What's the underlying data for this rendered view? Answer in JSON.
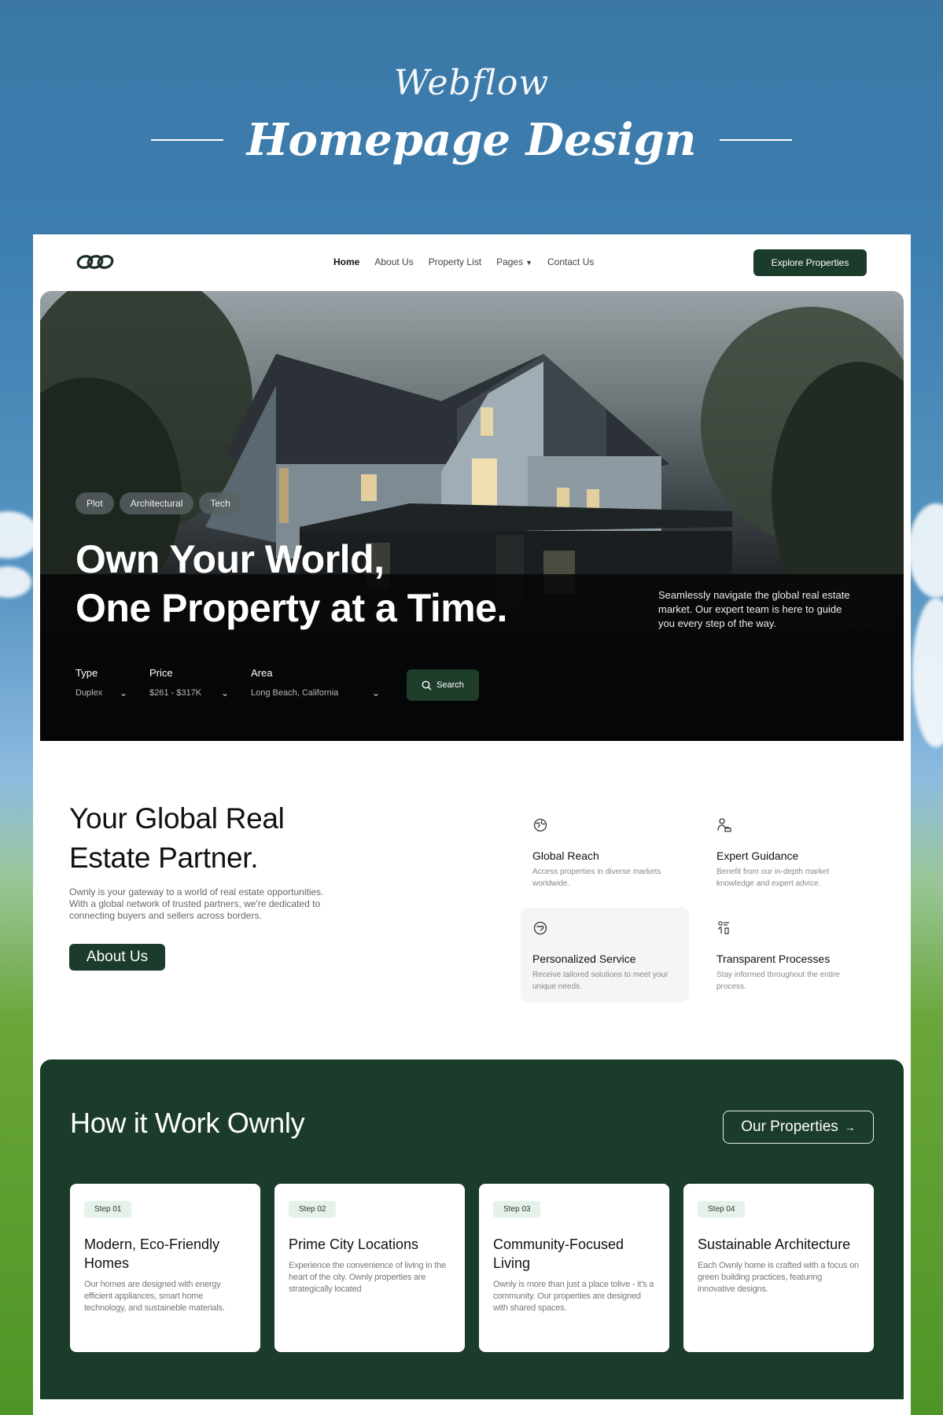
{
  "banner": {
    "script_top": "Webflow",
    "title": "Homepage Design"
  },
  "nav": {
    "links": [
      "Home",
      "About Us",
      "Property List",
      "Pages",
      "Contact Us"
    ],
    "cta": "Explore Properties"
  },
  "hero": {
    "tags": [
      "Plot",
      "Architectural",
      "Tech"
    ],
    "title_line1": "Own Your World,",
    "title_line2": "One Property at a Time.",
    "description": "Seamlessly navigate the global real estate market. Our expert team is here to guide you every step of the way.",
    "filters": [
      {
        "label": "Type",
        "value": "Duplex"
      },
      {
        "label": "Price",
        "value": "$261 - $317K"
      },
      {
        "label": "Area",
        "value": "Long Beach, California"
      }
    ],
    "search_label": "Search"
  },
  "partner": {
    "title_line1": "Your Global Real",
    "title_line2": "Estate Partner.",
    "text": "Ownly is your gateway to a world of real estate opportunities. With a global network of trusted partners, we're dedicated to connecting buyers and sellers across borders.",
    "button": "About Us",
    "features": [
      {
        "icon": "globe-icon",
        "title": "Global Reach",
        "desc": "Access properties in diverse markets worldwide."
      },
      {
        "icon": "guide-person-icon",
        "title": "Expert Guidance",
        "desc": "Benefit from our in-depth market knowledge and expert advice."
      },
      {
        "icon": "heart-hand-icon",
        "title": "Personalized Service",
        "desc": "Receive tailored solutions to meet your unique needs."
      },
      {
        "icon": "process-icon",
        "title": "Transparent Processes",
        "desc": "Stay informed throughout the entire process."
      }
    ]
  },
  "steps": {
    "title": "How it Work Ownly",
    "button": "Our Properties",
    "button_arrow": "→",
    "cards": [
      {
        "step": "Step 01",
        "title": "Modern, Eco-Friendly Homes",
        "desc": "Our homes are designed with energy efficient appliances, smart home technology, and sustaineble materials."
      },
      {
        "step": "Step 02",
        "title": "Prime City Locations",
        "desc": "Experience the convenience of living in the heart of the city. Ownly properties are strategically located"
      },
      {
        "step": "Step 03",
        "title": "Community-Focused Living",
        "desc": "Ownly is more than just a place tolive - it's a community. Our properties are designed with shared spaces."
      },
      {
        "step": "Step 04",
        "title": "Sustainable Architecture",
        "desc": "Each Ownly home is crafted with a focus on green building practices, featuring innovative designs."
      }
    ]
  },
  "colors": {
    "brand_green": "#1b3b2b",
    "step_badge_bg": "#e5f2ea",
    "background_sky": "#3a77a6"
  }
}
